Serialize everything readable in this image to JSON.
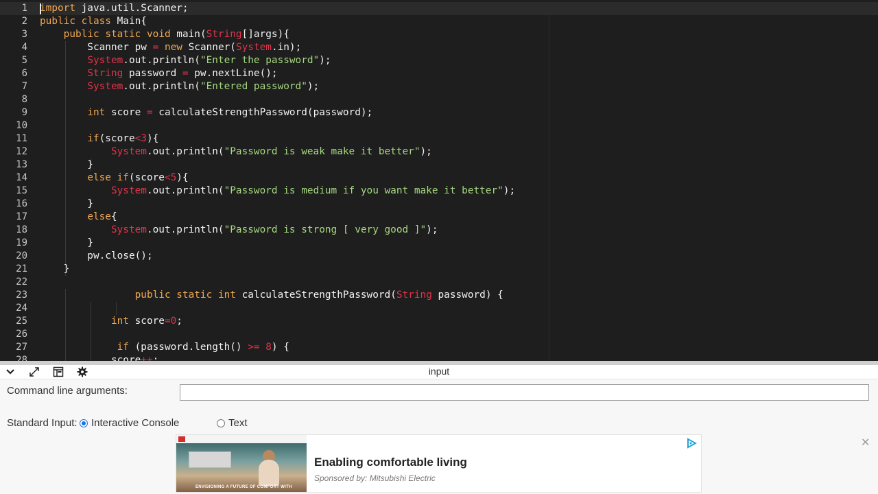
{
  "editor": {
    "lines": [
      {
        "n": "1",
        "tokens": [
          [
            "kw",
            "import"
          ],
          [
            "pl",
            " java.util.Scanner;"
          ]
        ]
      },
      {
        "n": "2",
        "tokens": [
          [
            "kw",
            "public"
          ],
          [
            "pl",
            " "
          ],
          [
            "kw",
            "class"
          ],
          [
            "pl",
            " Main{"
          ]
        ]
      },
      {
        "n": "3",
        "tokens": [
          [
            "pl",
            "    "
          ],
          [
            "kw",
            "public"
          ],
          [
            "pl",
            " "
          ],
          [
            "kw",
            "static"
          ],
          [
            "pl",
            " "
          ],
          [
            "kw",
            "void"
          ],
          [
            "pl",
            " main("
          ],
          [
            "ty",
            "String"
          ],
          [
            "pl",
            "[]args){"
          ]
        ]
      },
      {
        "n": "4",
        "tokens": [
          [
            "pl",
            "        Scanner pw "
          ],
          [
            "op",
            "="
          ],
          [
            "pl",
            " "
          ],
          [
            "kw",
            "new"
          ],
          [
            "pl",
            " Scanner("
          ],
          [
            "ty",
            "System"
          ],
          [
            "pl",
            ".in);"
          ]
        ]
      },
      {
        "n": "5",
        "tokens": [
          [
            "pl",
            "        "
          ],
          [
            "ty",
            "System"
          ],
          [
            "pl",
            ".out.println("
          ],
          [
            "st",
            "\"Enter the password\""
          ],
          [
            "pl",
            ");"
          ]
        ]
      },
      {
        "n": "6",
        "tokens": [
          [
            "pl",
            "        "
          ],
          [
            "ty",
            "String"
          ],
          [
            "pl",
            " password "
          ],
          [
            "op",
            "="
          ],
          [
            "pl",
            " pw.nextLine();"
          ]
        ]
      },
      {
        "n": "7",
        "tokens": [
          [
            "pl",
            "        "
          ],
          [
            "ty",
            "System"
          ],
          [
            "pl",
            ".out.println("
          ],
          [
            "st",
            "\"Entered password\""
          ],
          [
            "pl",
            ");"
          ]
        ]
      },
      {
        "n": "8",
        "tokens": []
      },
      {
        "n": "9",
        "tokens": [
          [
            "pl",
            "        "
          ],
          [
            "kw",
            "int"
          ],
          [
            "pl",
            " score "
          ],
          [
            "op",
            "="
          ],
          [
            "pl",
            " calculateStrengthPassword(password);"
          ]
        ]
      },
      {
        "n": "10",
        "tokens": []
      },
      {
        "n": "11",
        "tokens": [
          [
            "pl",
            "        "
          ],
          [
            "kw",
            "if"
          ],
          [
            "pl",
            "(score"
          ],
          [
            "op",
            "<"
          ],
          [
            "nm",
            "3"
          ],
          [
            "pl",
            "){"
          ]
        ]
      },
      {
        "n": "12",
        "tokens": [
          [
            "pl",
            "            "
          ],
          [
            "ty",
            "System"
          ],
          [
            "pl",
            ".out.println("
          ],
          [
            "st",
            "\"Password is weak make it better\""
          ],
          [
            "pl",
            ");"
          ]
        ]
      },
      {
        "n": "13",
        "tokens": [
          [
            "pl",
            "        }"
          ]
        ]
      },
      {
        "n": "14",
        "tokens": [
          [
            "pl",
            "        "
          ],
          [
            "kw",
            "else"
          ],
          [
            "pl",
            " "
          ],
          [
            "kw",
            "if"
          ],
          [
            "pl",
            "(score"
          ],
          [
            "op",
            "<"
          ],
          [
            "nm",
            "5"
          ],
          [
            "pl",
            "){"
          ]
        ]
      },
      {
        "n": "15",
        "tokens": [
          [
            "pl",
            "            "
          ],
          [
            "ty",
            "System"
          ],
          [
            "pl",
            ".out.println("
          ],
          [
            "st",
            "\"Password is medium if you want make it better\""
          ],
          [
            "pl",
            ");"
          ]
        ]
      },
      {
        "n": "16",
        "tokens": [
          [
            "pl",
            "        }"
          ]
        ]
      },
      {
        "n": "17",
        "tokens": [
          [
            "pl",
            "        "
          ],
          [
            "kw",
            "else"
          ],
          [
            "pl",
            "{"
          ]
        ]
      },
      {
        "n": "18",
        "tokens": [
          [
            "pl",
            "            "
          ],
          [
            "ty",
            "System"
          ],
          [
            "pl",
            ".out.println("
          ],
          [
            "st",
            "\"Password is strong [ very good ]\""
          ],
          [
            "pl",
            ");"
          ]
        ]
      },
      {
        "n": "19",
        "tokens": [
          [
            "pl",
            "        }"
          ]
        ]
      },
      {
        "n": "20",
        "tokens": [
          [
            "pl",
            "        pw.close();"
          ]
        ]
      },
      {
        "n": "21",
        "tokens": [
          [
            "pl",
            "    }"
          ]
        ]
      },
      {
        "n": "22",
        "tokens": []
      },
      {
        "n": "23",
        "tokens": [
          [
            "pl",
            "                "
          ],
          [
            "kw",
            "public"
          ],
          [
            "pl",
            " "
          ],
          [
            "kw",
            "static"
          ],
          [
            "pl",
            " "
          ],
          [
            "kw",
            "int"
          ],
          [
            "pl",
            " calculateStrengthPassword("
          ],
          [
            "ty",
            "String"
          ],
          [
            "pl",
            " password) {"
          ]
        ]
      },
      {
        "n": "24",
        "tokens": []
      },
      {
        "n": "25",
        "tokens": [
          [
            "pl",
            "            "
          ],
          [
            "kw",
            "int"
          ],
          [
            "pl",
            " score"
          ],
          [
            "op",
            "="
          ],
          [
            "nm",
            "0"
          ],
          [
            "pl",
            ";"
          ]
        ]
      },
      {
        "n": "26",
        "tokens": []
      },
      {
        "n": "27",
        "tokens": [
          [
            "pl",
            "             "
          ],
          [
            "kw",
            "if"
          ],
          [
            "pl",
            " (password.length() "
          ],
          [
            "op",
            ">="
          ],
          [
            "pl",
            " "
          ],
          [
            "nm",
            "8"
          ],
          [
            "pl",
            ") {"
          ]
        ]
      },
      {
        "n": "28",
        "tokens": [
          [
            "pl",
            "            score"
          ],
          [
            "op",
            "++"
          ],
          [
            "pl",
            ";"
          ]
        ]
      }
    ]
  },
  "panel": {
    "title": "input",
    "cmd_label": "Command line arguments:",
    "cmd_value": "",
    "stdin_label": "Standard Input:",
    "options": [
      {
        "label": "Interactive Console",
        "selected": true
      },
      {
        "label": "Text",
        "selected": false
      }
    ]
  },
  "ad": {
    "title": "Enabling comfortable living",
    "sponsor": "Sponsored by: Mitsubishi Electric",
    "image_caption": "ENVISIONING A FUTURE OF COMFORT WITH"
  },
  "colors": {
    "keyword": "#f0a852",
    "type": "#e0344a",
    "string": "#a5d87f",
    "editor_bg": "#1e1e1e"
  }
}
